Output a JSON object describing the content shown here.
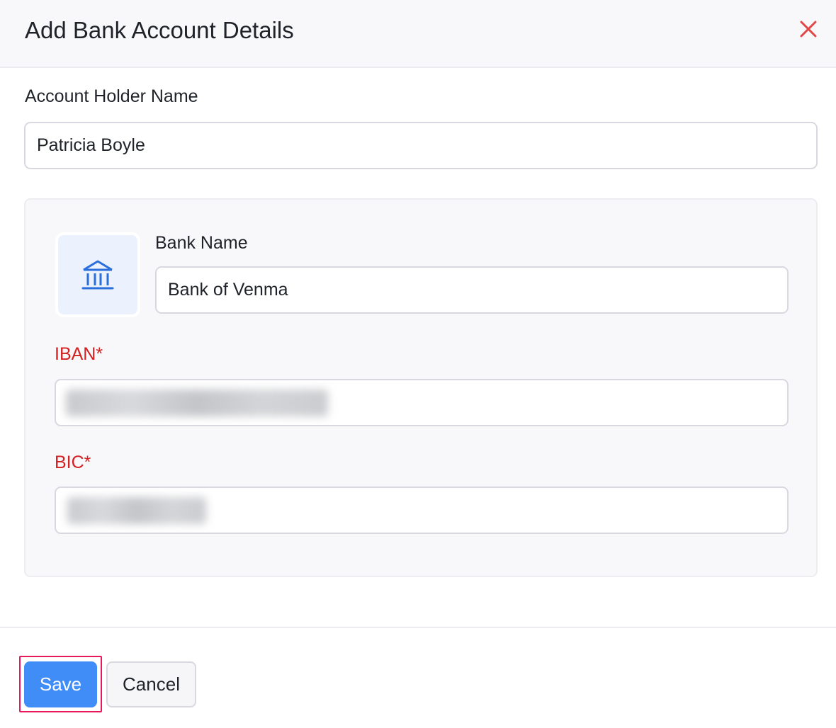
{
  "dialog": {
    "title": "Add Bank Account Details",
    "close_icon": "close-x-icon",
    "close_color": "#e04848"
  },
  "form": {
    "account_holder": {
      "label": "Account Holder Name",
      "value": "Patricia Boyle"
    },
    "bank": {
      "icon": "bank-building-icon",
      "icon_color": "#2a6fdb",
      "name_label": "Bank Name",
      "name_value": "Bank of Venma"
    },
    "iban": {
      "label": "IBAN*",
      "value_state": "blurred"
    },
    "bic": {
      "label": "BIC*",
      "value_state": "blurred"
    }
  },
  "footer": {
    "save_label": "Save",
    "cancel_label": "Cancel"
  },
  "colors": {
    "accent": "#408df7",
    "required": "#d32020",
    "highlight_outline": "#e8195a"
  }
}
